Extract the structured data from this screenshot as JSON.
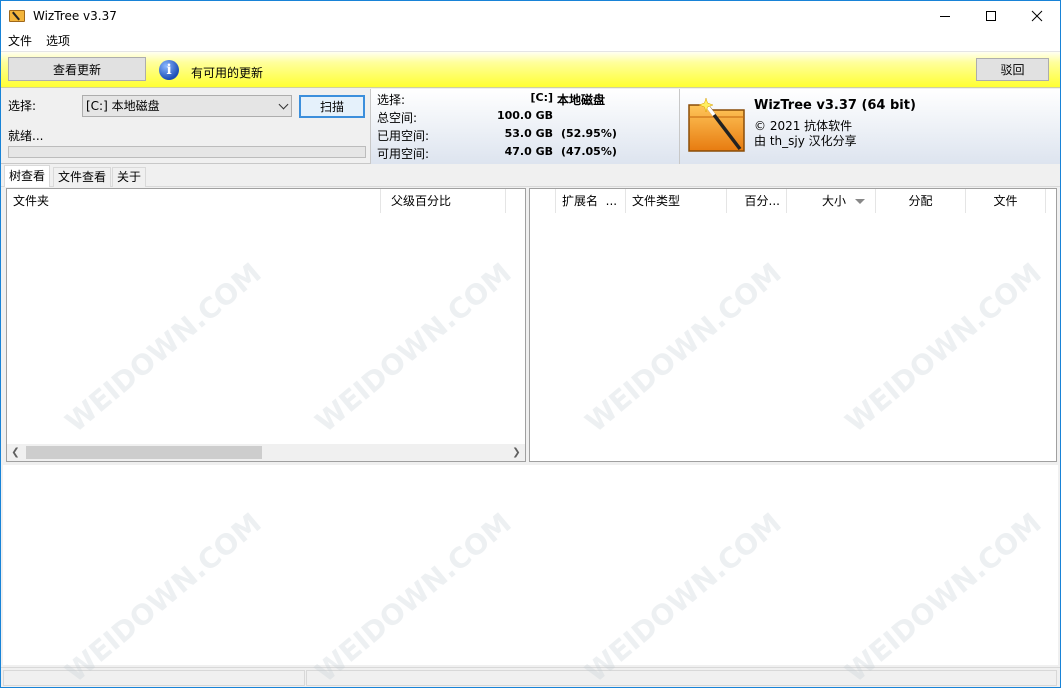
{
  "window": {
    "title": "WizTree v3.37"
  },
  "menu": {
    "items": [
      "文件",
      "选项"
    ]
  },
  "update_bar": {
    "check_label": "查看更新",
    "message": "有可用的更新",
    "dismiss_label": "驳回",
    "info_glyph": "i"
  },
  "drive": {
    "select_label": "选择:",
    "selected": "[C:] 本地磁盘",
    "scan_label": "扫描",
    "status": "就绪...",
    "progress_percent": 0
  },
  "stats": {
    "select_key": "选择:",
    "drive_letter": "[C:]",
    "drive_name": "本地磁盘",
    "total_key": "总空间:",
    "total_value": "100.0 GB",
    "used_key": "已用空间:",
    "used_value": "53.0 GB",
    "used_percent": "(52.95%)",
    "free_key": "可用空间:",
    "free_value": "47.0 GB",
    "free_percent": "(47.05%)"
  },
  "about": {
    "title": "WizTree v3.37 (64 bit)",
    "copyright": "© 2021 抗体软件",
    "credit": "由 th_sjy 汉化分享"
  },
  "tabs": [
    "树查看",
    "文件查看",
    "关于"
  ],
  "tree_columns": [
    "文件夹",
    "父级百分比"
  ],
  "ext_columns": [
    "扩展名",
    "...",
    "文件类型",
    "百分...",
    "大小",
    "分配",
    "文件"
  ],
  "colors": {
    "accent_blue": "#1883d7",
    "update_yellow": "#ffff33",
    "logo_orange": "#f59a1c"
  },
  "watermark": "WEIDOWN.COM"
}
